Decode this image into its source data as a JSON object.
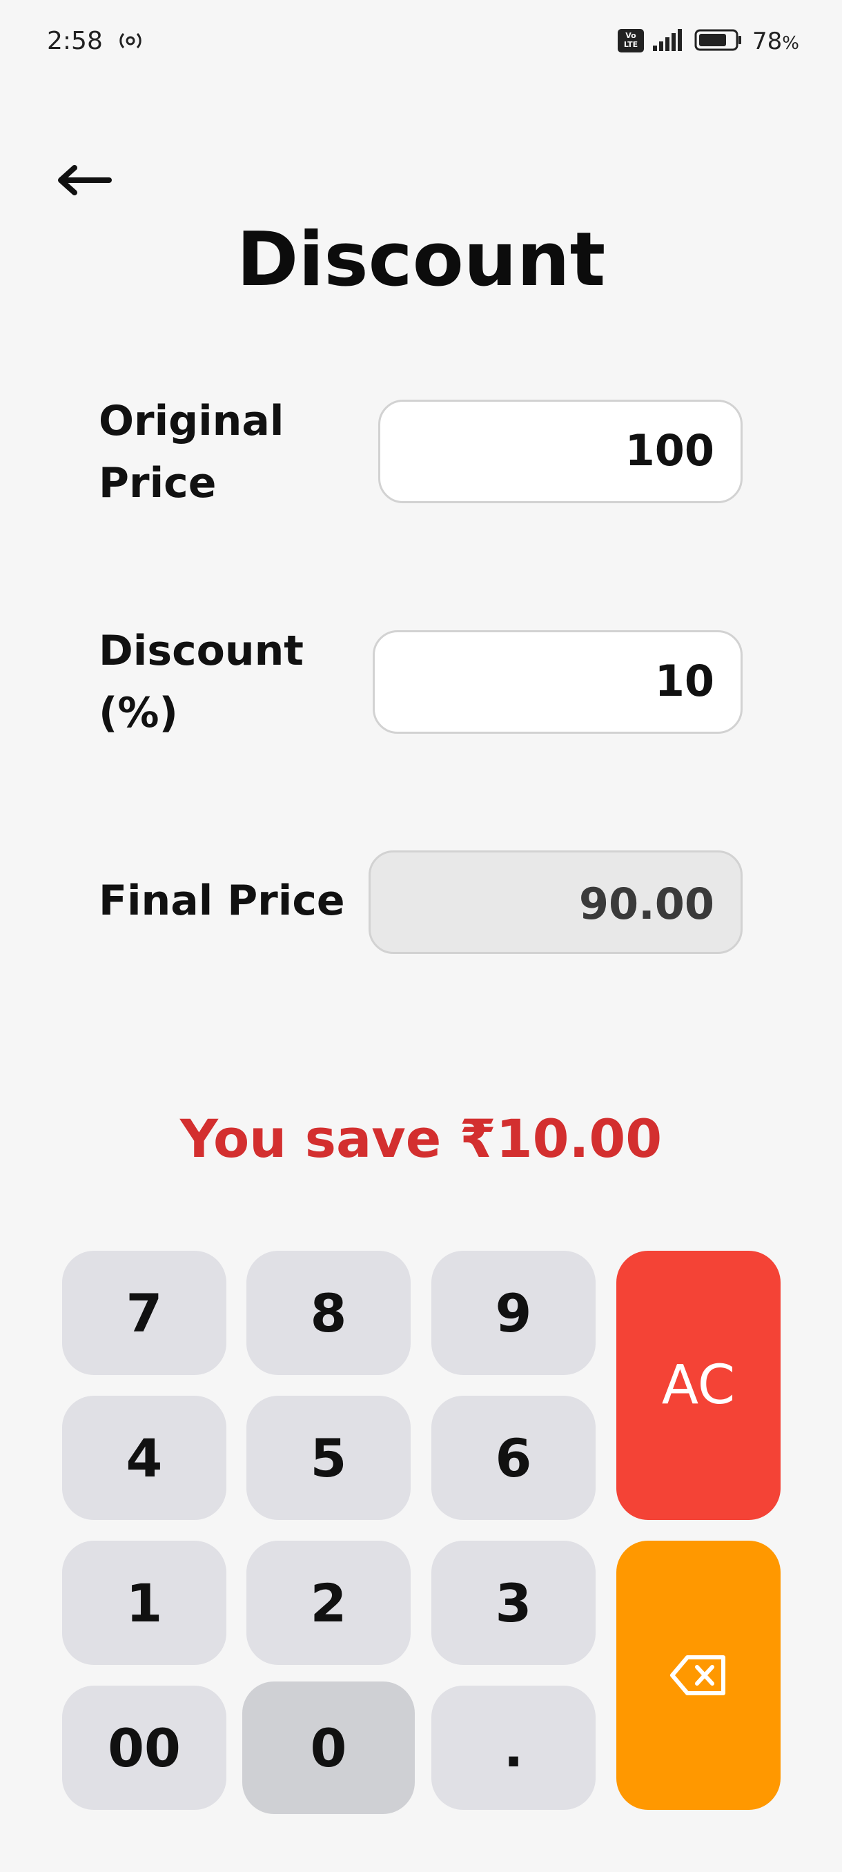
{
  "status_bar": {
    "time": "2:58",
    "volte_label": "Vo\nLTE",
    "battery_percent": "78",
    "battery_unit": "%",
    "battery_level": 0.78,
    "hotspot_icon": "hotspot-icon",
    "signal_icon": "signal-icon",
    "battery_icon": "battery-icon"
  },
  "header": {
    "back_icon": "arrow-left-icon",
    "title": "Discount"
  },
  "form": {
    "original_price": {
      "label_line1": "Original",
      "label_line2": "Price",
      "value": "100"
    },
    "discount": {
      "label_line1": "Discount",
      "label_line2": "(%)",
      "value": "10"
    },
    "final_price": {
      "label": "Final Price",
      "value": "90.00"
    }
  },
  "savings_text": "You save ₹10.00",
  "keypad": {
    "keys": [
      "7",
      "8",
      "9",
      "4",
      "5",
      "6",
      "1",
      "2",
      "3",
      "00",
      "0",
      "."
    ],
    "clear_label": "AC",
    "backspace_icon": "backspace-icon"
  },
  "colors": {
    "background": "#f6f6f6",
    "key": "#e0e0e5",
    "key_pressed": "#cfd0d4",
    "clear": "#f44336",
    "backspace": "#ff9800",
    "savings": "#d32f2f"
  }
}
